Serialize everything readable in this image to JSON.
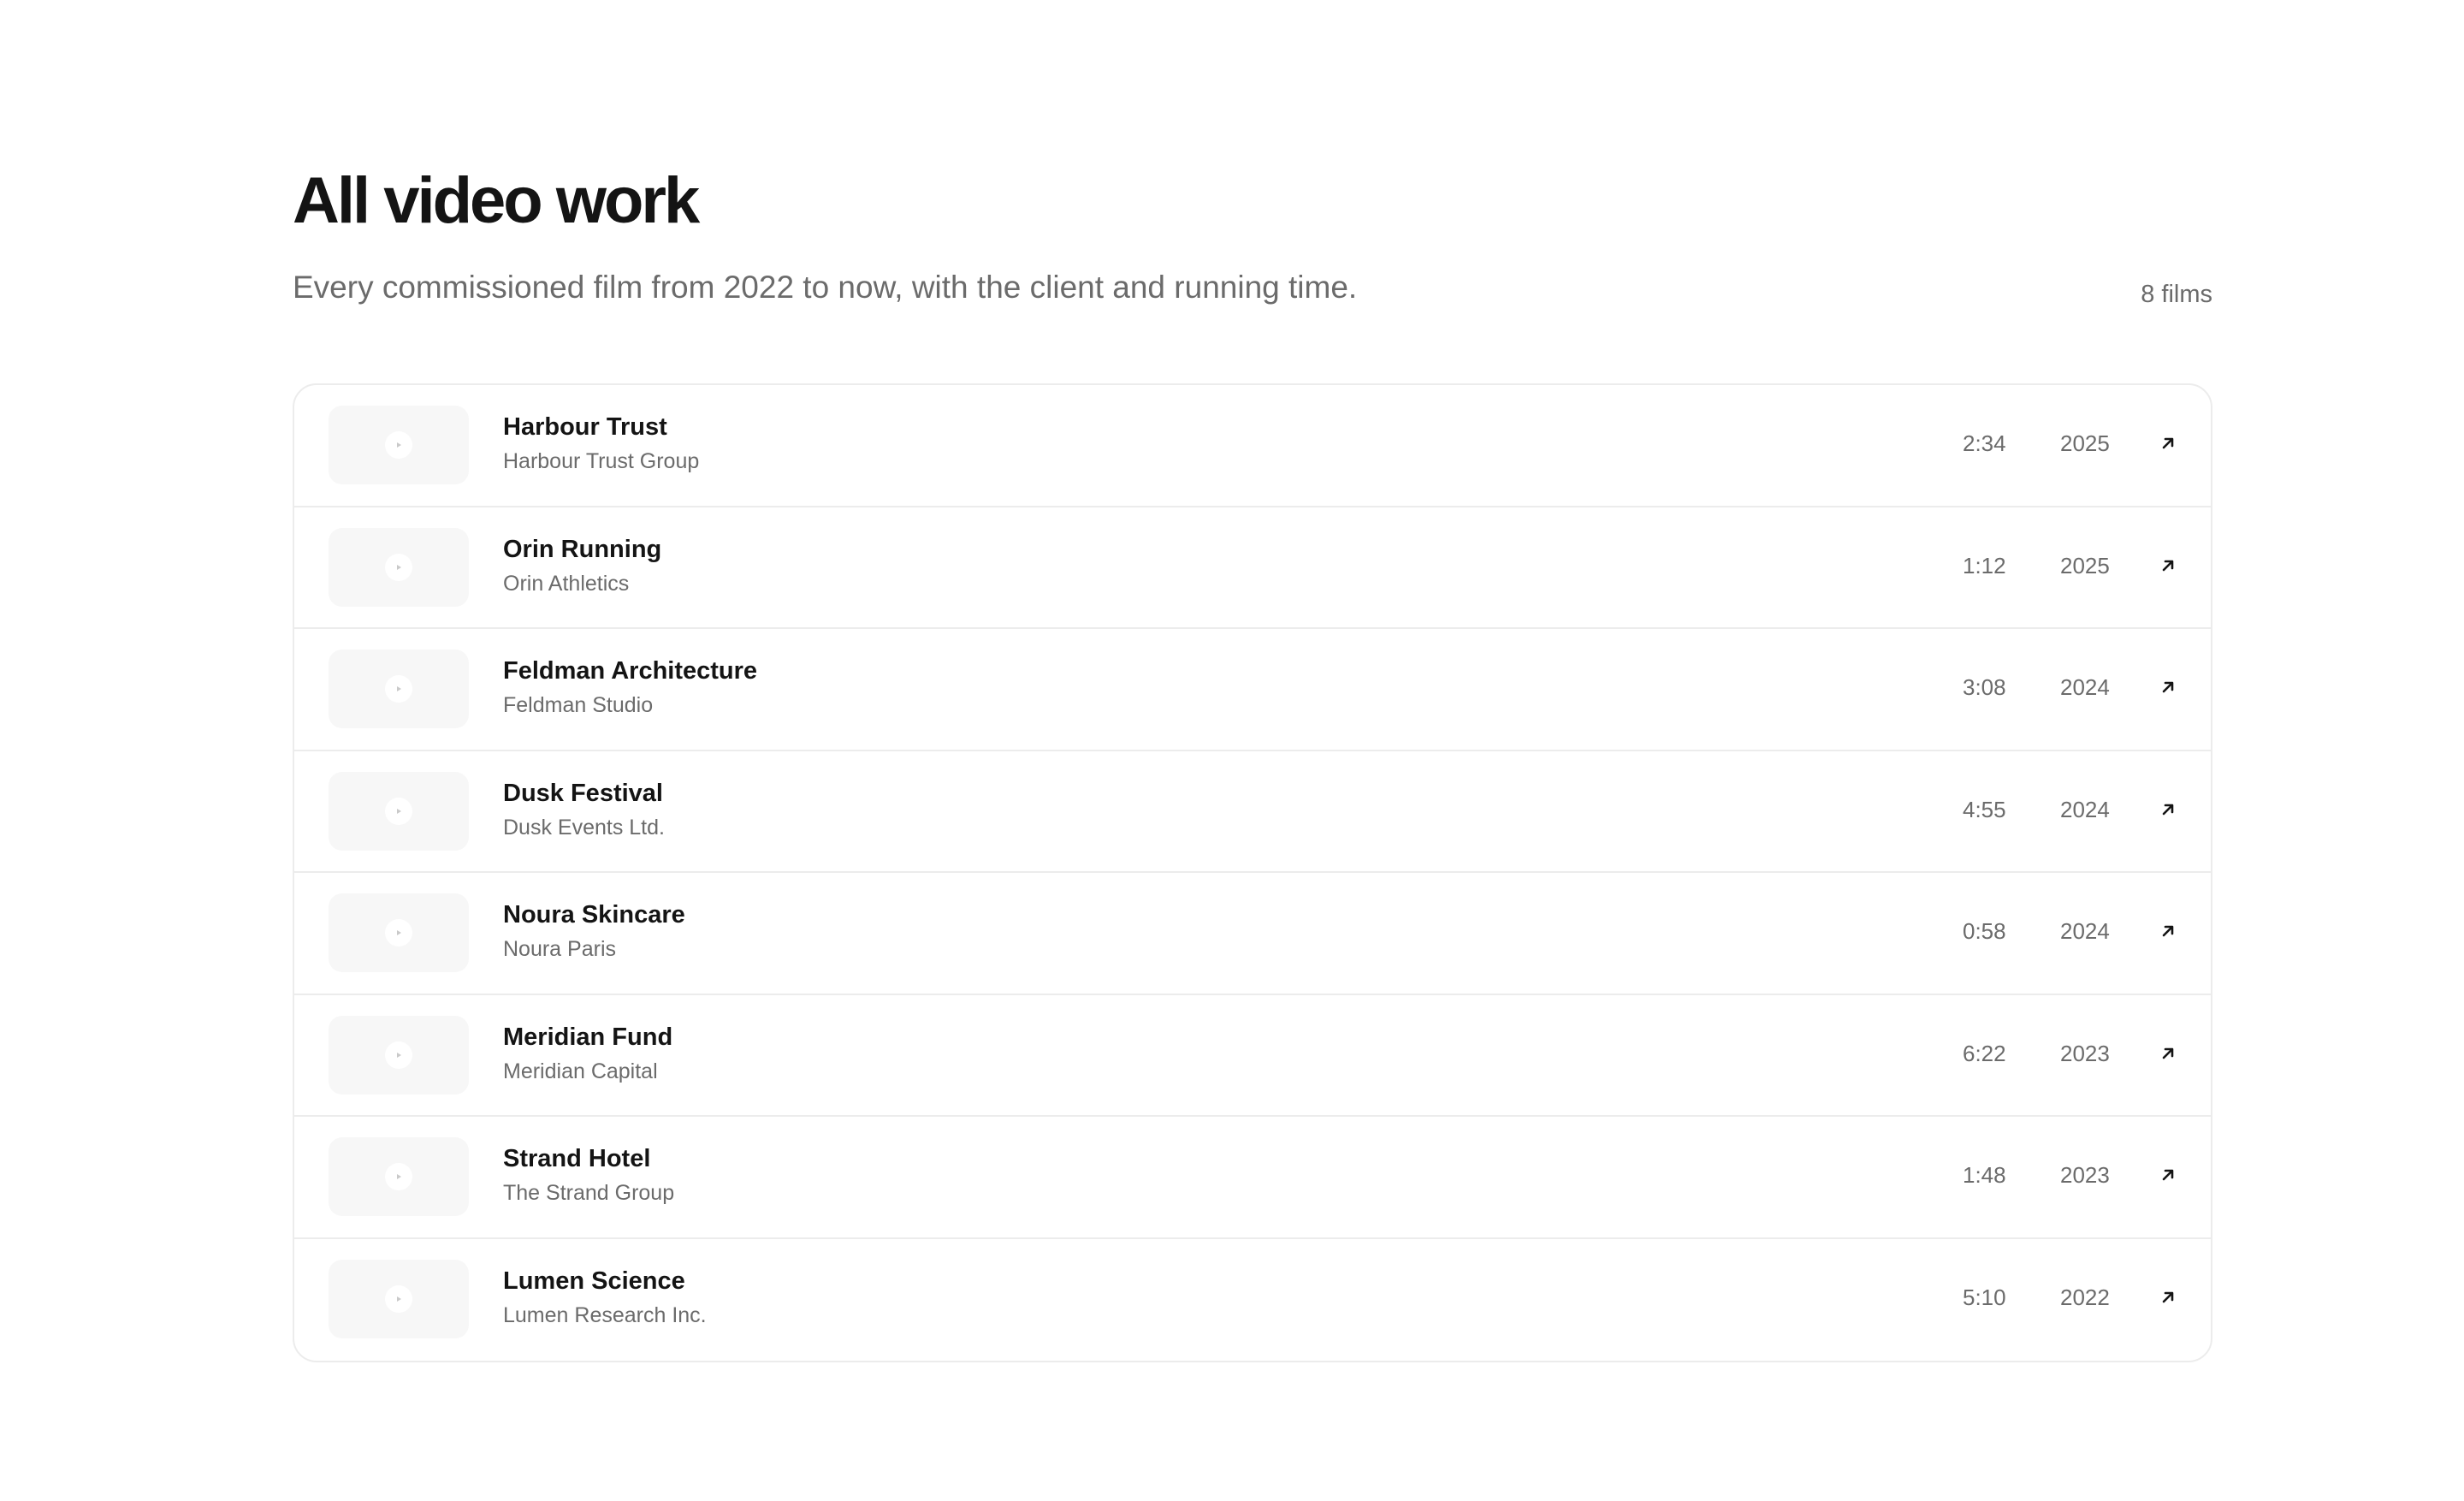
{
  "header": {
    "title": "All video work",
    "subtitle": "Every commissioned film from 2022 to now, with the client and running time.",
    "count": "8 films"
  },
  "films": [
    {
      "title": "Harbour Trust",
      "client": "Harbour Trust Group",
      "duration": "2:34",
      "year": "2025"
    },
    {
      "title": "Orin Running",
      "client": "Orin Athletics",
      "duration": "1:12",
      "year": "2025"
    },
    {
      "title": "Feldman Architecture",
      "client": "Feldman Studio",
      "duration": "3:08",
      "year": "2024"
    },
    {
      "title": "Dusk Festival",
      "client": "Dusk Events Ltd.",
      "duration": "4:55",
      "year": "2024"
    },
    {
      "title": "Noura Skincare",
      "client": "Noura Paris",
      "duration": "0:58",
      "year": "2024"
    },
    {
      "title": "Meridian Fund",
      "client": "Meridian Capital",
      "duration": "6:22",
      "year": "2023"
    },
    {
      "title": "Strand Hotel",
      "client": "The Strand Group",
      "duration": "1:48",
      "year": "2023"
    },
    {
      "title": "Lumen Science",
      "client": "Lumen Research Inc.",
      "duration": "5:10",
      "year": "2022"
    }
  ],
  "icons": {
    "thumbnail": "play-icon",
    "row_action": "arrow-up-right-icon"
  },
  "colors": {
    "text": "#141414",
    "muted": "#6b6b6b",
    "border": "#ececec",
    "thumb_bg": "#f7f7f7"
  }
}
